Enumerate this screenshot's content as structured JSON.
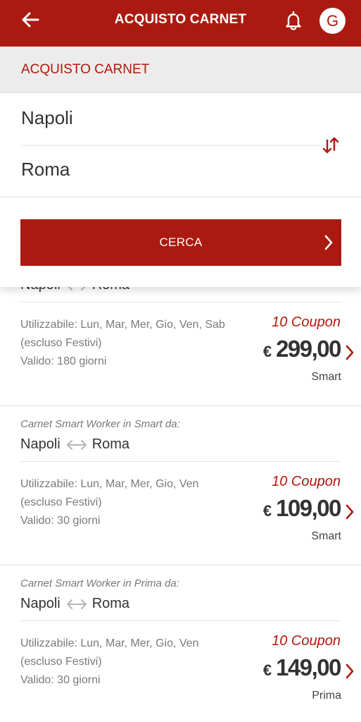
{
  "header": {
    "title": "ACQUISTO CARNET",
    "avatar_initial": "G"
  },
  "subheader": {
    "label": "ACQUISTO CARNET"
  },
  "stations": {
    "from": "Napoli",
    "to": "Roma"
  },
  "search": {
    "button_label": "CERCA"
  },
  "colors": {
    "brand": "#ab1a10",
    "accent_text": "#b3160b"
  },
  "results": [
    {
      "type": "",
      "from": "Napoli",
      "to": "Roma",
      "days": "Utilizzabile: Lun, Mar, Mer, Gio, Ven, Sab",
      "holidays": "(escluso Festivi)",
      "validity": "Valido: 180 giorni",
      "coupons": "10 Coupon",
      "currency": "€",
      "price": "299,00",
      "class": "Smart"
    },
    {
      "type": "Carnet Smart Worker in Smart da:",
      "from": "Napoli",
      "to": "Roma",
      "days": "Utilizzabile: Lun, Mar, Mer, Gio, Ven",
      "holidays": "(escluso Festivi)",
      "validity": "Valido: 30 giorni",
      "coupons": "10 Coupon",
      "currency": "€",
      "price": "109,00",
      "class": "Smart"
    },
    {
      "type": "Carnet Smart Worker in Prima da:",
      "from": "Napoli",
      "to": "Roma",
      "days": "Utilizzabile: Lun, Mar, Mer, Gio, Ven",
      "holidays": "(escluso Festivi)",
      "validity": "Valido: 30 giorni",
      "coupons": "10 Coupon",
      "currency": "€",
      "price": "149,00",
      "class": "Prima"
    }
  ]
}
